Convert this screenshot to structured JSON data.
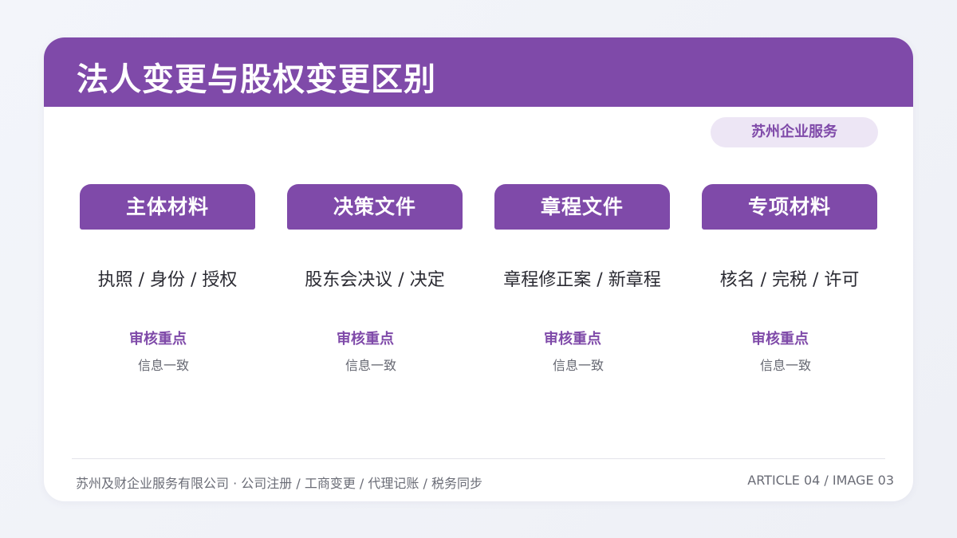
{
  "title": "法人变更与股权变更区别",
  "badge": "苏州企业服务",
  "columns": [
    {
      "tab": "主体材料",
      "items": "执照 / 身份 / 授权",
      "review_label": "审核重点",
      "review_value": "信息一致"
    },
    {
      "tab": "决策文件",
      "items": "股东会决议 / 决定",
      "review_label": "审核重点",
      "review_value": "信息一致"
    },
    {
      "tab": "章程文件",
      "items": "章程修正案 / 新章程",
      "review_label": "审核重点",
      "review_value": "信息一致"
    },
    {
      "tab": "专项材料",
      "items": "核名 / 完税 / 许可",
      "review_label": "审核重点",
      "review_value": "信息一致"
    }
  ],
  "footer": {
    "left": "苏州及财企业服务有限公司 · 公司注册 / 工商变更 / 代理记账 / 税务同步",
    "right": "ARTICLE 04 / IMAGE 03"
  },
  "colors": {
    "accent": "#7f4aa9",
    "badge_bg": "#ede6f5",
    "text": "#2b2b33",
    "muted": "#666872"
  }
}
